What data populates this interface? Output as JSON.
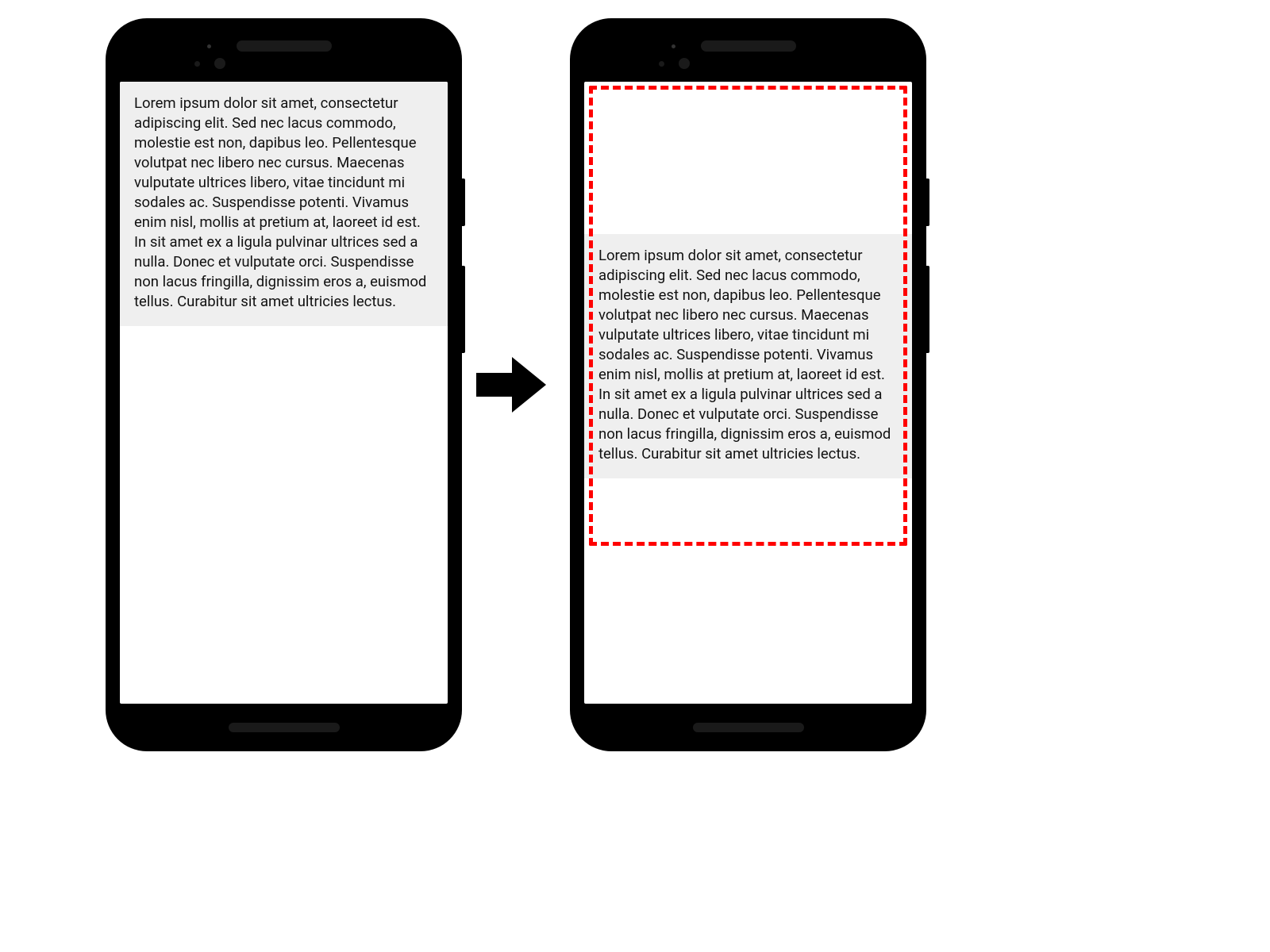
{
  "lorem_text": "Lorem ipsum dolor sit amet, consectetur adipiscing elit. Sed nec lacus commodo, molestie est non, dapibus leo. Pellentesque volutpat nec libero nec cursus. Maecenas vulputate ultrices libero, vitae tincidunt mi sodales ac. Suspendisse potenti. Vivamus enim nisl, mollis at pretium at, laoreet id est. In sit amet ex a ligula pulvinar ultrices sed a nulla. Donec et vulputate orci. Suspendisse non lacus fringilla, dignissim eros a, euismod tellus. Curabitur sit amet ultricies lectus.",
  "colors": {
    "dashed_border": "#ff0000",
    "text_bg": "#efefef",
    "phone_body": "#000000"
  }
}
